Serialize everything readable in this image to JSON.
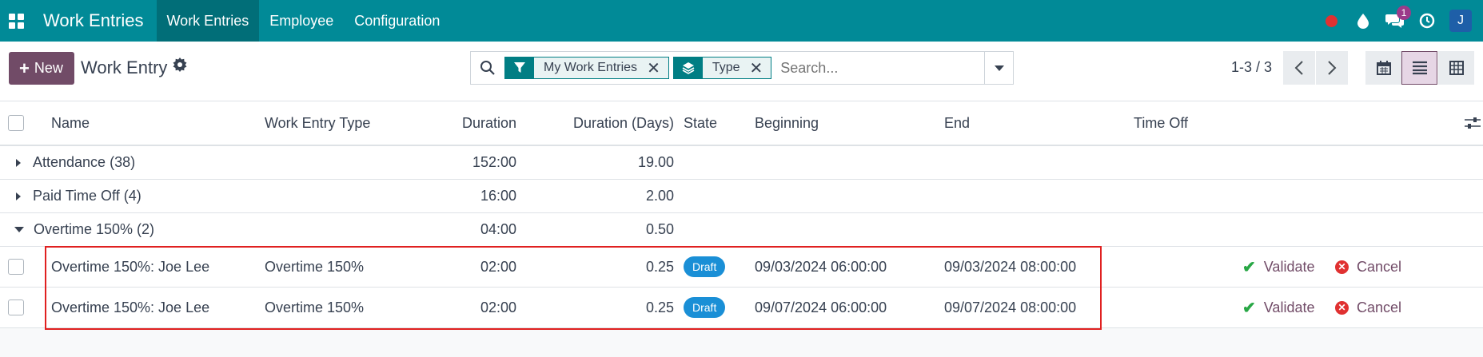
{
  "navbar": {
    "app_title": "Work Entries",
    "menu": [
      "Work Entries",
      "Employee",
      "Configuration"
    ],
    "chat_count": "1",
    "user_initial": "J",
    "colors": {
      "navbar_bg": "#018a97",
      "active_item_bg": "#016e78",
      "record_dot": "#e03131"
    }
  },
  "control": {
    "new_label": "New",
    "page_title": "Work Entry",
    "facets": [
      {
        "icon": "filter-icon",
        "label": "My Work Entries"
      },
      {
        "icon": "layers-icon",
        "label": "Type"
      }
    ],
    "search_placeholder": "Search...",
    "pager": "1-3 / 3",
    "views": [
      "calendar-icon",
      "list-icon",
      "pivot-icon"
    ],
    "active_view": "list-icon"
  },
  "table": {
    "columns": [
      "Name",
      "Work Entry Type",
      "Duration",
      "Duration (Days)",
      "State",
      "Beginning",
      "End",
      "Time Off"
    ],
    "groups": [
      {
        "label": "Attendance (38)",
        "duration": "152:00",
        "days": "19.00",
        "expanded": false
      },
      {
        "label": "Paid Time Off (4)",
        "duration": "16:00",
        "days": "2.00",
        "expanded": false
      },
      {
        "label": "Overtime 150% (2)",
        "duration": "04:00",
        "days": "0.50",
        "expanded": true
      }
    ],
    "records": [
      {
        "name": "Overtime 150%: Joe Lee",
        "type": "Overtime 150%",
        "duration": "02:00",
        "days": "0.25",
        "state": "Draft",
        "beginning": "09/03/2024 06:00:00",
        "end": "09/03/2024 08:00:00",
        "validate": "Validate",
        "cancel": "Cancel"
      },
      {
        "name": "Overtime 150%: Joe Lee",
        "type": "Overtime 150%",
        "duration": "02:00",
        "days": "0.25",
        "state": "Draft",
        "beginning": "09/07/2024 06:00:00",
        "end": "09/07/2024 08:00:00",
        "validate": "Validate",
        "cancel": "Cancel"
      }
    ],
    "colors": {
      "draft_badge": "#1a8fd6",
      "validate_check": "#28a745",
      "cancel_icon": "#e03131",
      "primary": "#714b67",
      "highlight_border": "#e02020"
    }
  }
}
